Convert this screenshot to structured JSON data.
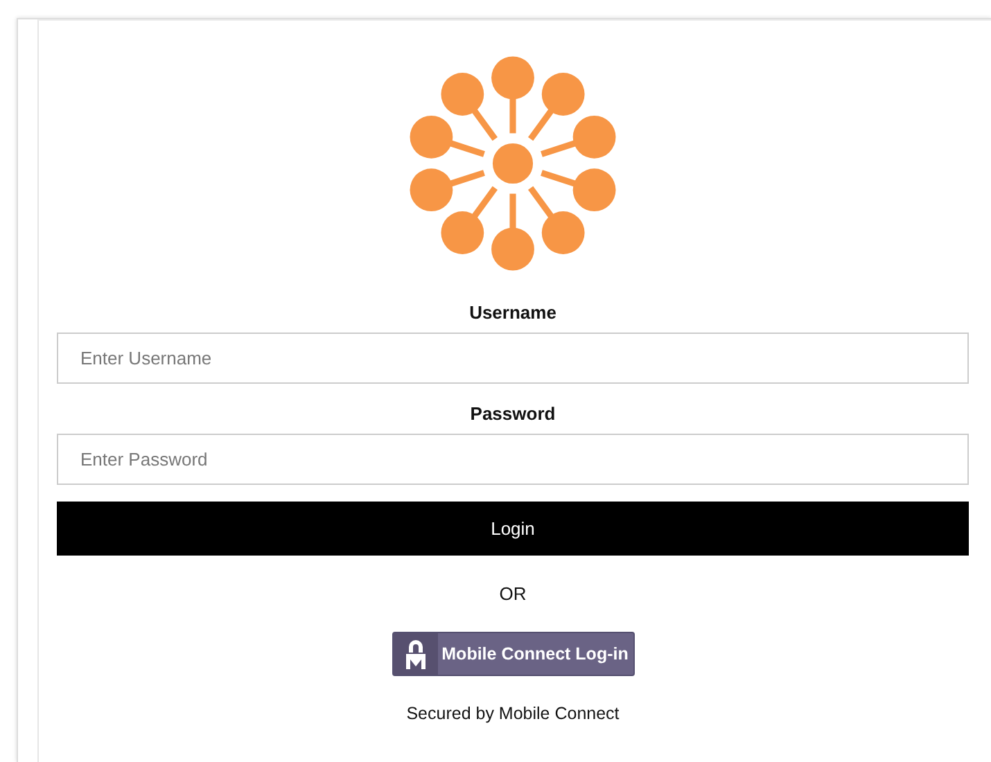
{
  "form": {
    "username_label": "Username",
    "username_placeholder": "Enter Username",
    "password_label": "Password",
    "password_placeholder": "Enter Password",
    "login_button": "Login",
    "separator": "OR",
    "mobile_connect_button": "Mobile Connect Log-in",
    "footer": "Secured by Mobile Connect"
  }
}
